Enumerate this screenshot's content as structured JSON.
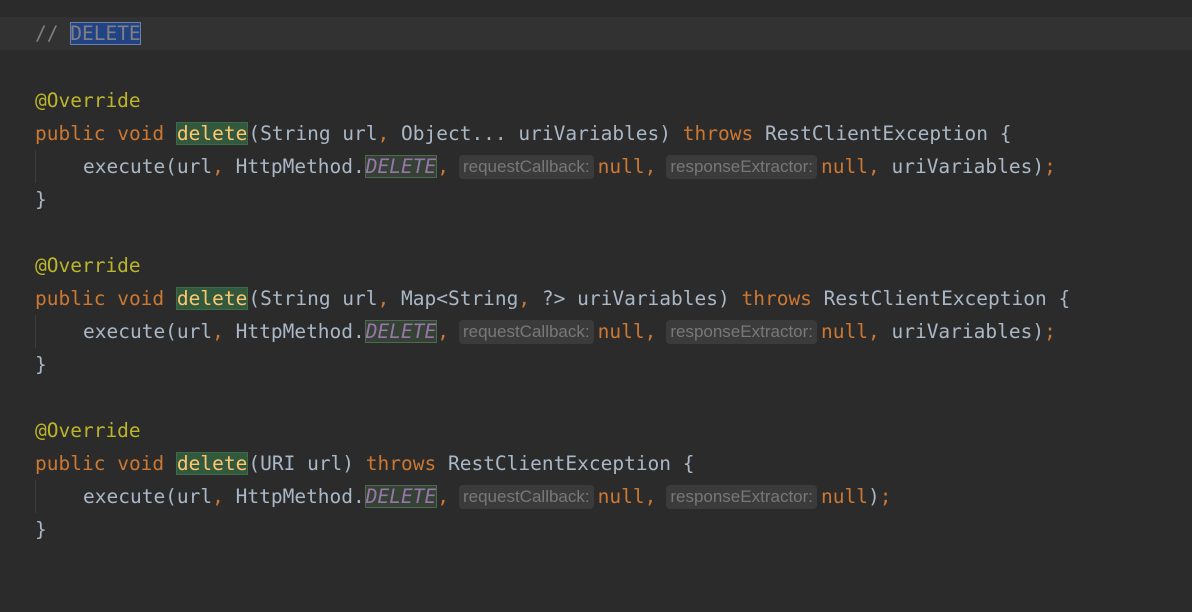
{
  "comment": {
    "prefix": "// ",
    "word": "DELETE"
  },
  "methods": [
    {
      "annotation": "@Override",
      "kw_public": "public",
      "kw_void": "void",
      "name": "delete",
      "sig_a": "(String url",
      "sig_comma": ",",
      "sig_b": " Object... uriVariables) ",
      "throws": "throws",
      "exception": " RestClientException {",
      "call_start": "execute(url",
      "call_comma1": ",",
      "call_mid": " HttpMethod.",
      "const": "DELETE",
      "call_comma2": ",",
      "hint1": "requestCallback:",
      "null1": "null",
      "comma3": ",",
      "hint2": "responseExtractor:",
      "null2": "null",
      "tail_comma": ",",
      "tail": " uriVariables)",
      "semi": ";",
      "close": "}"
    },
    {
      "annotation": "@Override",
      "kw_public": "public",
      "kw_void": "void",
      "name": "delete",
      "sig_a": "(String url",
      "sig_comma": ",",
      "sig_b": " Map<String",
      "sig_comma2": ",",
      "sig_c": " ?> uriVariables) ",
      "throws": "throws",
      "exception": " RestClientException {",
      "call_start": "execute(url",
      "call_comma1": ",",
      "call_mid": " HttpMethod.",
      "const": "DELETE",
      "call_comma2": ",",
      "hint1": "requestCallback:",
      "null1": "null",
      "comma3": ",",
      "hint2": "responseExtractor:",
      "null2": "null",
      "tail_comma": ",",
      "tail": " uriVariables)",
      "semi": ";",
      "close": "}"
    },
    {
      "annotation": "@Override",
      "kw_public": "public",
      "kw_void": "void",
      "name": "delete",
      "sig_a": "(URI url) ",
      "throws": "throws",
      "exception": " RestClientException {",
      "call_start": "execute(url",
      "call_comma1": ",",
      "call_mid": " HttpMethod.",
      "const": "DELETE",
      "call_comma2": ",",
      "hint1": "requestCallback:",
      "null1": "null",
      "comma3": ",",
      "hint2": "responseExtractor:",
      "null2": "null",
      "tail": ")",
      "semi": ";",
      "close": "}"
    }
  ]
}
